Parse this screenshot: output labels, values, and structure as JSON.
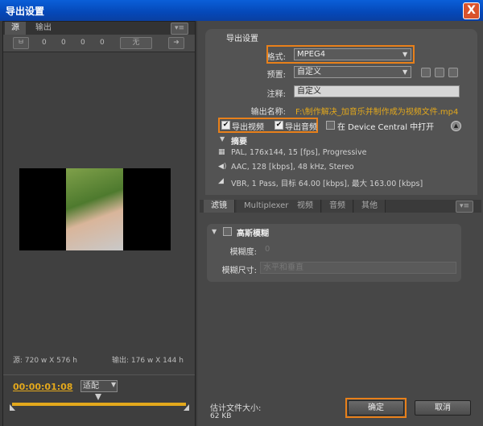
{
  "window": {
    "title": "导出设置",
    "close_label": "X"
  },
  "left": {
    "tabs": [
      "源",
      "输出"
    ],
    "toolbar": {
      "crop": "ㅂ",
      "offsets": [
        "0",
        "0",
        "0",
        "0"
      ],
      "none_select": "无"
    },
    "source_info": "源: 720 w X 576 h",
    "output_info": "输出: 176 w X 144 h",
    "timecode": "00:00:01:08",
    "fit_label": "适配"
  },
  "export_settings": {
    "section_title": "导出设置",
    "format_label": "格式:",
    "format_value": "MPEG4",
    "preset_label": "预置:",
    "preset_value": "自定义",
    "comment_label": "注释:",
    "comment_value": "自定义",
    "output_name_label": "输出名称:",
    "output_name_value": "F:\\制作解决_加音乐并制作成为视频文件.mp4",
    "export_video": "导出视频",
    "export_audio": "导出音频",
    "device_central": "在 Device Central 中打开",
    "summary_title": "摘要",
    "summary_lines": [
      "PAL, 176x144, 15 [fps], Progressive",
      "AAC, 128 [kbps], 48 kHz, Stereo",
      "VBR, 1 Pass, 目标 64.00 [kbps], 最大 163.00 [kbps]"
    ]
  },
  "lower_tabs": [
    "滤镜",
    "Multiplexer",
    "视频",
    "音频",
    "其他"
  ],
  "filter": {
    "title": "高斯模糊",
    "blur_label": "模糊度:",
    "blur_value": "0",
    "dim_label": "模糊尺寸:",
    "dim_value": "水平和垂直"
  },
  "footer": {
    "size_label": "估计文件大小:",
    "size_value": "62 KB",
    "ok": "确定",
    "cancel": "取消"
  },
  "colors": {
    "accent": "#e8801a",
    "timecode": "#e3a81c",
    "titlebar": "#0548b8"
  }
}
